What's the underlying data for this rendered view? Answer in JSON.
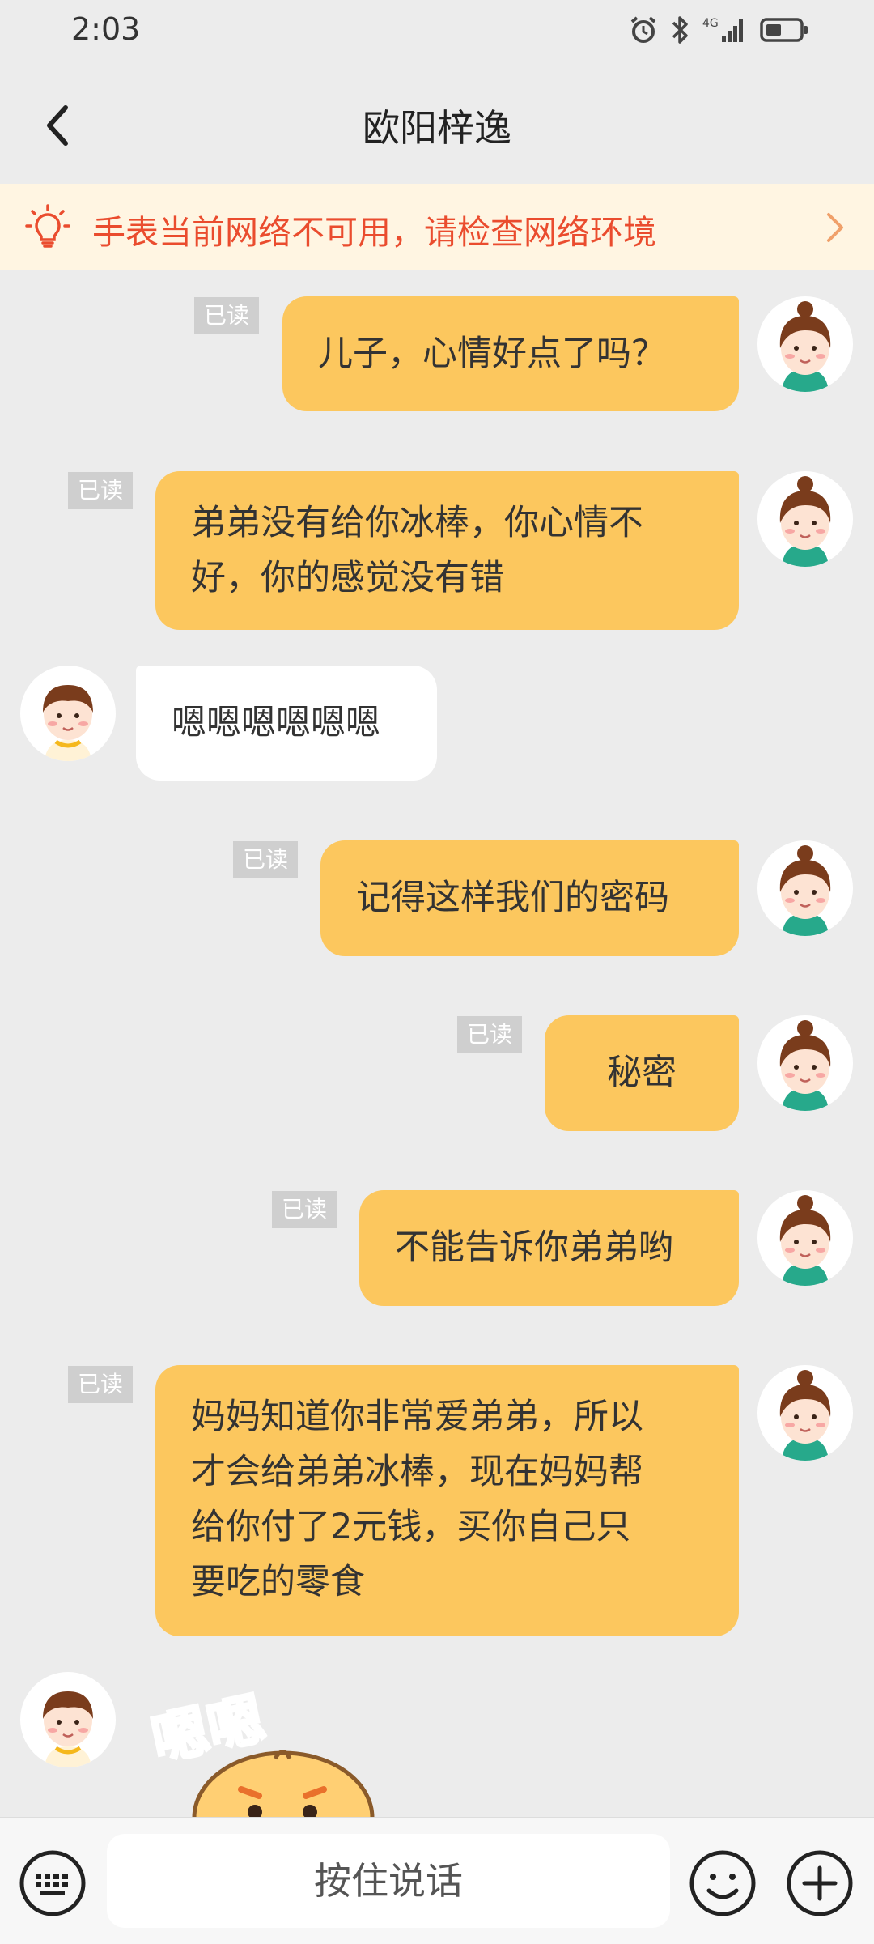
{
  "status_bar": {
    "time": "2:03",
    "signal_label": "4G"
  },
  "header": {
    "title": "欧阳梓逸"
  },
  "banner": {
    "text": "手表当前网络不可用，请检查网络环境"
  },
  "read_label": "已读",
  "messages": [
    {
      "side": "out",
      "lines": [
        "儿子，心情好点了吗？"
      ],
      "read": true
    },
    {
      "side": "out",
      "lines": [
        "弟弟没有给你冰棒，你心情不",
        "好，你的感觉没有错"
      ],
      "read": true
    },
    {
      "side": "in",
      "lines": [
        "嗯嗯嗯嗯嗯嗯"
      ],
      "read": false
    },
    {
      "side": "out",
      "lines": [
        "记得这样我们的密码"
      ],
      "read": true
    },
    {
      "side": "out",
      "lines": [
        "秘密"
      ],
      "read": true
    },
    {
      "side": "out",
      "lines": [
        "不能告诉你弟弟哟"
      ],
      "read": true
    },
    {
      "side": "out",
      "lines": [
        "妈妈知道你非常爱弟弟，所以",
        "才会给弟弟冰棒，现在妈妈帮",
        "给你付了2元钱，买你自己只",
        "要吃的零食"
      ],
      "read": true
    },
    {
      "side": "in",
      "sticker": true,
      "sticker_text": "嗯嗯",
      "read": false
    }
  ],
  "input": {
    "voice_label": "按住说话"
  },
  "icons": {
    "back": "chevron-left-icon",
    "bulb": "lightbulb-icon",
    "arrow": "chevron-right-icon",
    "keyboard": "keyboard-icon",
    "emoji": "emoji-icon",
    "plus": "plus-icon"
  },
  "colors": {
    "out_bubble": "#fcc75e",
    "in_bubble": "#ffffff",
    "banner_bg": "#fff5e2",
    "banner_text": "#ea4c2e",
    "page_bg": "#ececec"
  }
}
